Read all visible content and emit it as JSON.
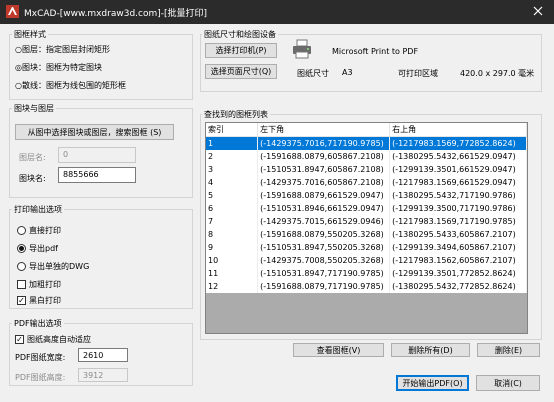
{
  "window": {
    "title": "MxCAD-[www.mxdraw3d.com]-[批量打印]"
  },
  "frame_style": {
    "label": "图框样式",
    "options": [
      "○图层：指定图层封闭矩形",
      "◎图块：图框为特定图块",
      "○散线：图框为线包围的矩形框"
    ],
    "selected": 1
  },
  "block_layer": {
    "label": "图块与图层",
    "select_button": "从图中选择图块或图层，搜索图框 (S)",
    "layer_name_label": "图层名:",
    "layer_name_value": "0",
    "block_name_label": "图块名:",
    "block_name_value": "8855666"
  },
  "print_output": {
    "label": "打印输出选项",
    "options": [
      "直接打印",
      "导出pdf",
      "导出单独的DWG"
    ],
    "selected": 1,
    "checks": [
      {
        "label": "加粗打印",
        "checked": false
      },
      {
        "label": "黑白打印",
        "checked": true
      }
    ]
  },
  "pdf_output": {
    "label": "PDF输出选项",
    "auto_fit_label": "图纸高度自动适应",
    "auto_fit_checked": true,
    "width_label": "PDF图纸宽度:",
    "width_value": "2610",
    "height_label": "PDF图纸高度:",
    "height_value": "3912"
  },
  "paper": {
    "label": "图纸尺寸和绘图设备",
    "select_printer": "选择打印机(P)",
    "select_page_size": "选择页面尺寸(Q)",
    "printer_name": "Microsoft Print to PDF",
    "paper_size_label": "图纸尺寸",
    "paper_size_value": "A3",
    "printable_area_label": "可打印区域",
    "printable_area_value": "420.0 x 297.0 毫米"
  },
  "list": {
    "label": "查找到的图框列表",
    "columns": [
      "索引",
      "左下角",
      "右上角"
    ],
    "rows": [
      [
        "1",
        "(-1429375.7016,717190.9785)",
        "(-1217983.1569,772852.8624)"
      ],
      [
        "2",
        "(-1591688.0879,605867.2108)",
        "(-1380295.5432,661529.0947)"
      ],
      [
        "3",
        "(-1510531.8947,605867.2108)",
        "(-1299139.3501,661529.0947)"
      ],
      [
        "4",
        "(-1429375.7016,605867.2108)",
        "(-1217983.1569,661529.0947)"
      ],
      [
        "5",
        "(-1591688.0879,661529.0947)",
        "(-1380295.5432,717190.9786)"
      ],
      [
        "6",
        "(-1510531.8946,661529.0947)",
        "(-1299139.3500,717190.9786)"
      ],
      [
        "7",
        "(-1429375.7015,661529.0946)",
        "(-1217983.1569,717190.9785)"
      ],
      [
        "8",
        "(-1591688.0879,550205.3268)",
        "(-1380295.5433,605867.2107)"
      ],
      [
        "9",
        "(-1510531.8947,550205.3268)",
        "(-1299139.3494,605867.2107)"
      ],
      [
        "10",
        "(-1429375.7008,550205.3268)",
        "(-1217983.1562,605867.2107)"
      ],
      [
        "11",
        "(-1510531.8947,717190.9785)",
        "(-1299139.3501,772852.8624)"
      ],
      [
        "12",
        "(-1591688.0879,717190.9785)",
        "(-1380295.5432,772852.8624)"
      ]
    ],
    "selected_row": 0
  },
  "buttons": {
    "view_frame": "查看图框(V)",
    "delete_all": "删除所有(D)",
    "delete": "删除(E)",
    "start_output": "开始输出PDF(O)",
    "cancel": "取消(C)"
  },
  "icons": {
    "app": "mxcad-app-icon",
    "close": "close-icon",
    "printer": "printer-icon"
  },
  "colors": {
    "titlebar": "#2b2b2b",
    "selection": "#0078d7",
    "window_bg": "#f0f0f0"
  }
}
